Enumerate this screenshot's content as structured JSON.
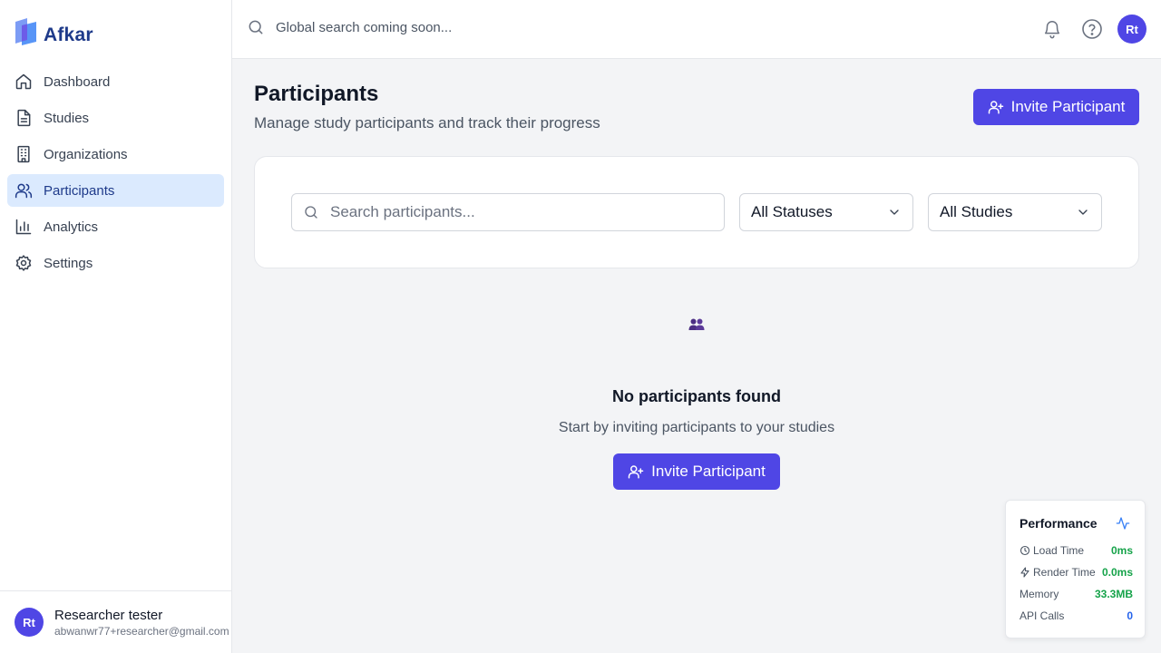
{
  "app": {
    "name": "Afkar"
  },
  "sidebar": {
    "items": [
      {
        "label": "Dashboard",
        "icon": "home-icon"
      },
      {
        "label": "Studies",
        "icon": "document-icon"
      },
      {
        "label": "Organizations",
        "icon": "building-icon"
      },
      {
        "label": "Participants",
        "icon": "users-icon",
        "active": true
      },
      {
        "label": "Analytics",
        "icon": "bar-chart-icon"
      },
      {
        "label": "Settings",
        "icon": "gear-icon"
      }
    ],
    "user": {
      "initials": "Rt",
      "name": "Researcher tester",
      "email": "abwanwr77+researcher@gmail.com"
    }
  },
  "topbar": {
    "search_text": "Global search coming soon...",
    "avatar_initials": "Rt"
  },
  "page": {
    "title": "Participants",
    "subtitle": "Manage study participants and track their progress",
    "invite_label": "Invite Participant"
  },
  "filters": {
    "search_placeholder": "Search participants...",
    "status_selected": "All Statuses",
    "study_selected": "All Studies"
  },
  "empty_state": {
    "title": "No participants found",
    "text": "Start by inviting participants to your studies",
    "button_label": "Invite Participant"
  },
  "performance": {
    "title": "Performance",
    "rows": [
      {
        "label": "Load Time",
        "value": "0ms"
      },
      {
        "label": "Render Time",
        "value": "0.0ms"
      },
      {
        "label": "Memory",
        "value": "33.3MB"
      },
      {
        "label": "API Calls",
        "value": "0"
      }
    ]
  },
  "colors": {
    "accent": "#4f46e5",
    "active_nav_bg": "#dbeafe",
    "brand_text": "#1e3a8a",
    "metric_green": "#16a34a",
    "metric_blue": "#2563eb"
  }
}
